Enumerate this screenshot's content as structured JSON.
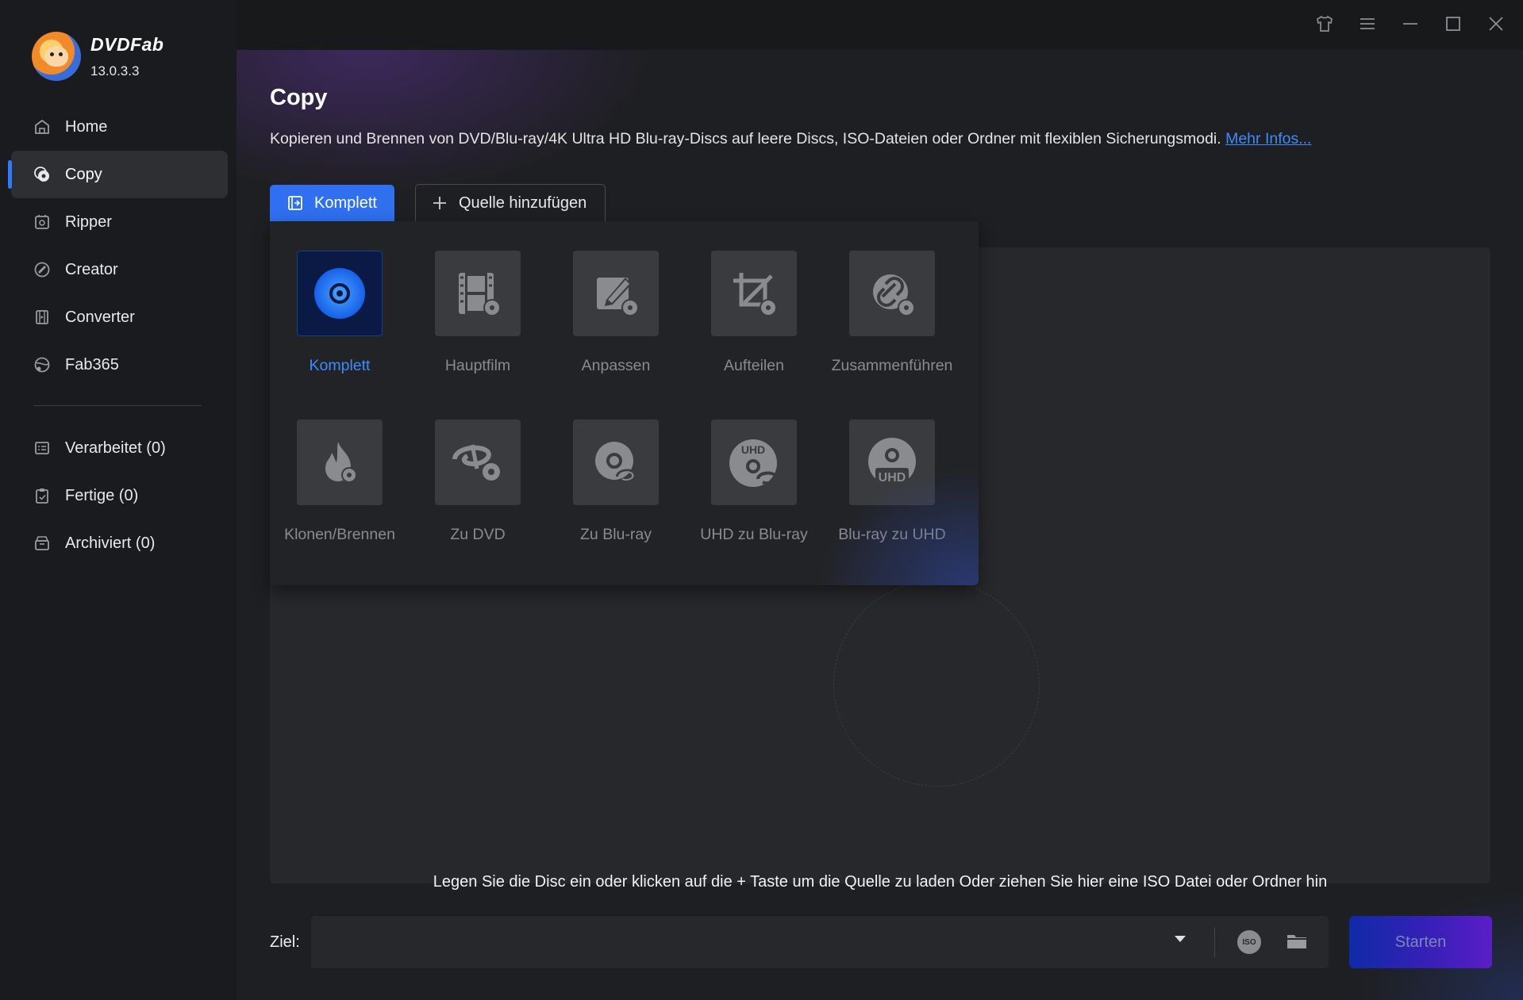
{
  "app": {
    "name": "DVDFab",
    "version": "13.0.3.3"
  },
  "sidebar": {
    "items": [
      {
        "label": "Home",
        "icon": "home-icon"
      },
      {
        "label": "Copy",
        "icon": "copy-icon",
        "active": true
      },
      {
        "label": "Ripper",
        "icon": "ripper-icon"
      },
      {
        "label": "Creator",
        "icon": "creator-icon"
      },
      {
        "label": "Converter",
        "icon": "converter-icon"
      },
      {
        "label": "Fab365",
        "icon": "fab365-icon"
      }
    ],
    "queue": [
      {
        "label": "Verarbeitet (0)",
        "icon": "processing-list-icon"
      },
      {
        "label": "Fertige (0)",
        "icon": "finished-clipboard-icon"
      },
      {
        "label": "Archiviert (0)",
        "icon": "archive-box-icon"
      }
    ]
  },
  "titlebar": {
    "icons": [
      "tshirt-skin-icon",
      "menu-icon",
      "minimize-icon",
      "maximize-icon",
      "close-icon"
    ]
  },
  "page": {
    "title": "Copy",
    "description": "Kopieren und Brennen von DVD/Blu-ray/4K Ultra HD Blu-ray-Discs auf leere Discs, ISO-Dateien oder Ordner mit flexiblen Sicherungsmodi.",
    "more_link": "Mehr Infos..."
  },
  "toolbar": {
    "mode_label": "Komplett",
    "add_source_label": "Quelle hinzufügen"
  },
  "modes": [
    {
      "label": "Komplett",
      "selected": true
    },
    {
      "label": "Hauptfilm"
    },
    {
      "label": "Anpassen"
    },
    {
      "label": "Aufteilen"
    },
    {
      "label": "Zusammenführen"
    },
    {
      "label": "Klonen/Brennen"
    },
    {
      "label": "Zu DVD"
    },
    {
      "label": "Zu Blu-ray"
    },
    {
      "label": "UHD zu Blu-ray"
    },
    {
      "label": "Blu-ray zu UHD"
    }
  ],
  "dropzone": {
    "hint": "Legen Sie die Disc ein oder klicken auf die + Taste um die Quelle zu laden Oder ziehen Sie hier eine ISO Datei oder Ordner hin"
  },
  "bottom": {
    "target_label": "Ziel:",
    "target_value": "",
    "iso_label": "ISO",
    "start_label": "Starten"
  },
  "colors": {
    "accent": "#2f6ff0",
    "link": "#3d8bff",
    "sidebar_bg": "#1a1b1e",
    "main_bg": "#1e1f22"
  },
  "mode_badges": {
    "uhd": "UHD"
  }
}
